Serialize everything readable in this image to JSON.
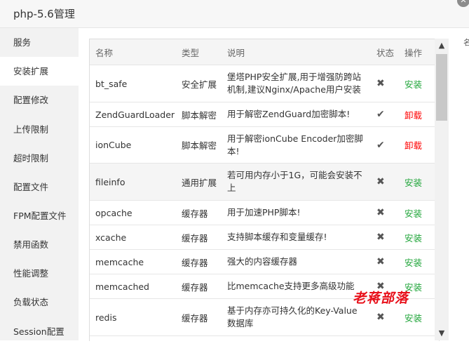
{
  "window": {
    "title": "php-5.6管理"
  },
  "sidebar": {
    "items": [
      {
        "label": "服务"
      },
      {
        "label": "安装扩展"
      },
      {
        "label": "配置修改"
      },
      {
        "label": "上传限制"
      },
      {
        "label": "超时限制"
      },
      {
        "label": "配置文件"
      },
      {
        "label": "FPM配置文件"
      },
      {
        "label": "禁用函数"
      },
      {
        "label": "性能调整"
      },
      {
        "label": "负载状态"
      },
      {
        "label": "Session配置"
      }
    ],
    "active_index": 1
  },
  "table": {
    "headers": [
      "名称",
      "类型",
      "说明",
      "状态",
      "操作"
    ],
    "rows": [
      {
        "name": "bt_safe",
        "type": "安全扩展",
        "desc": "堡塔PHP安全扩展,用于增强防跨站机制,建议Nginx/Apache用户安装",
        "status_icon": "✖",
        "action": "安装",
        "installed": false,
        "highlight": false
      },
      {
        "name": "ZendGuardLoader",
        "type": "脚本解密",
        "desc": "用于解密ZendGuard加密脚本!",
        "status_icon": "✔",
        "action": "卸载",
        "installed": true,
        "highlight": false
      },
      {
        "name": "ionCube",
        "type": "脚本解密",
        "desc": "用于解密ionCube Encoder加密脚本!",
        "status_icon": "✔",
        "action": "卸载",
        "installed": true,
        "highlight": false
      },
      {
        "name": "fileinfo",
        "type": "通用扩展",
        "desc": "若可用内存小于1G，可能会安装不上",
        "status_icon": "✖",
        "action": "安装",
        "installed": false,
        "highlight": true
      },
      {
        "name": "opcache",
        "type": "缓存器",
        "desc": "用于加速PHP脚本!",
        "status_icon": "✖",
        "action": "安装",
        "installed": false,
        "highlight": false
      },
      {
        "name": "xcache",
        "type": "缓存器",
        "desc": "支持脚本缓存和变量缓存!",
        "status_icon": "✖",
        "action": "安装",
        "installed": false,
        "highlight": false
      },
      {
        "name": "memcache",
        "type": "缓存器",
        "desc": "强大的内容缓存器",
        "status_icon": "✖",
        "action": "安装",
        "installed": false,
        "highlight": false
      },
      {
        "name": "memcached",
        "type": "缓存器",
        "desc": "比memcache支持更多高级功能",
        "status_icon": "✖",
        "action": "安装",
        "installed": false,
        "highlight": false
      },
      {
        "name": "redis",
        "type": "缓存器",
        "desc": "基于内存亦可持久化的Key-Value数据库",
        "status_icon": "✖",
        "action": "安装",
        "installed": false,
        "highlight": false
      }
    ]
  },
  "side_glyph": "名",
  "watermark": "老蒋部落",
  "colors": {
    "install": "#20a53a",
    "uninstall": "#ff0000",
    "watermark": "#e8101a"
  }
}
